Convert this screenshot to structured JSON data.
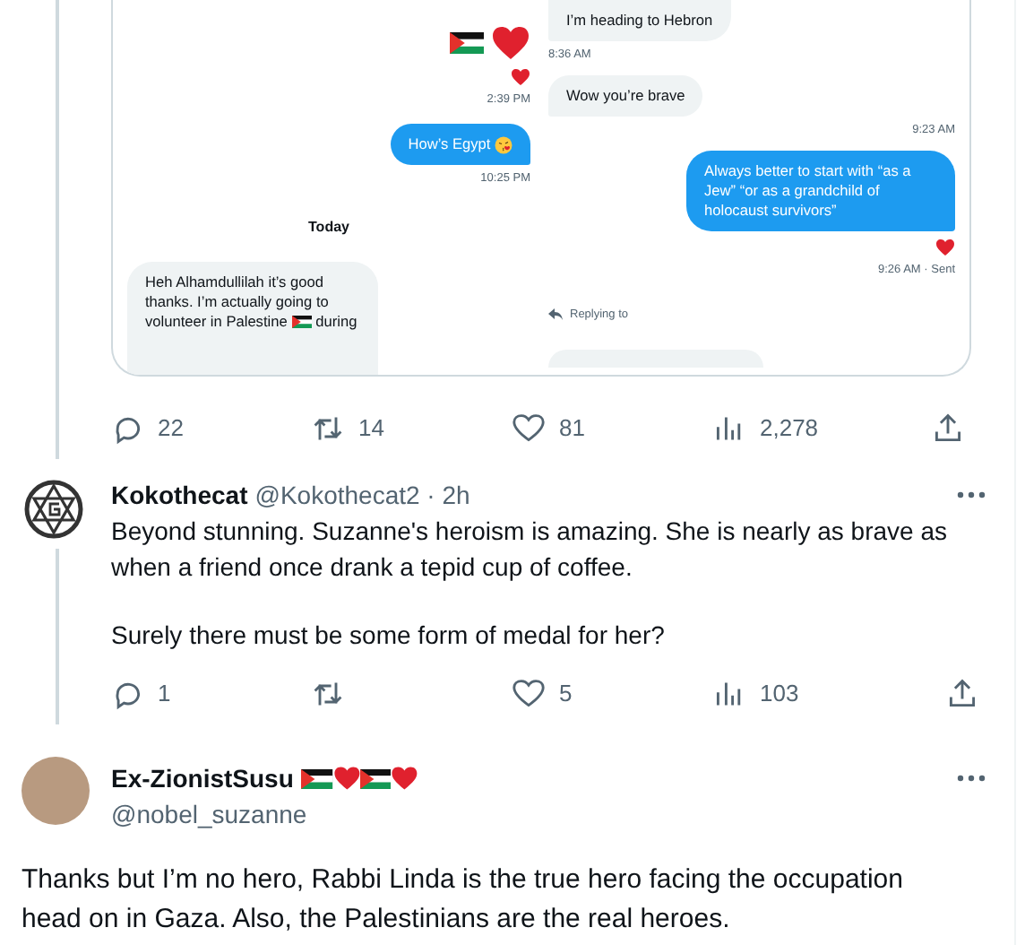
{
  "quoted_media": {
    "left_panel": [
      {
        "kind": "emoji",
        "icons": [
          {
            "kind": "flag"
          },
          {
            "kind": "heart"
          }
        ]
      },
      {
        "kind": "reaction"
      },
      {
        "kind": "time",
        "text": "2:39 PM"
      },
      {
        "kind": "bubble",
        "from_me": true,
        "segments": [
          {
            "kind": "text",
            "text": "How’s Egypt"
          },
          {
            "kind": "kiss"
          }
        ]
      },
      {
        "kind": "time",
        "text": "10:25 PM"
      },
      {
        "kind": "date",
        "text": "Today"
      },
      {
        "kind": "bubble",
        "from_me": false,
        "clipped_bottom": true,
        "segments": [
          {
            "kind": "text",
            "text": "Heh Alhamdullilah it’s good thanks. I’m actually going to volunteer in Palestine"
          },
          {
            "kind": "flag"
          },
          {
            "kind": "text",
            "text": "during"
          }
        ]
      }
    ],
    "right_panel": [
      {
        "kind": "bubble",
        "from_me": false,
        "clipped_top": true,
        "segments": [
          {
            "kind": "text",
            "text": "I’m heading to Hebron"
          }
        ]
      },
      {
        "kind": "time",
        "text": "8:36 AM",
        "left_aligned": true
      },
      {
        "kind": "bubble",
        "from_me": false,
        "segments": [
          {
            "kind": "text",
            "text": "Wow you’re brave"
          }
        ]
      },
      {
        "kind": "time",
        "text": "9:23 AM"
      },
      {
        "kind": "bubble",
        "from_me": true,
        "segments": [
          {
            "kind": "text",
            "text": "Always better to start with “as a Jew” “or as a grandchild of holocaust survivors”"
          }
        ]
      },
      {
        "kind": "reaction"
      },
      {
        "kind": "time",
        "text": "9:26 AM · Sent"
      },
      {
        "kind": "replying",
        "text": "Replying to"
      }
    ]
  },
  "actions": [
    {
      "kind": "reply",
      "count": "22"
    },
    {
      "kind": "retweet",
      "count": "14"
    },
    {
      "kind": "like",
      "count": "81"
    },
    {
      "kind": "views",
      "count": "2,278"
    },
    {
      "kind": "share"
    }
  ],
  "replies": [
    {
      "avatar": {
        "kind": "star"
      },
      "name": "Kokothecat",
      "handle": "@Kokothecat2 · 2h",
      "paragraphs": [
        "Beyond stunning. Suzanne's heroism is amazing. She is nearly as brave as when a friend once drank a tepid cup of coffee.",
        "Surely there must be some form of medal for her?"
      ],
      "actions": [
        {
          "kind": "reply",
          "count": "1"
        },
        {
          "kind": "retweet"
        },
        {
          "kind": "like",
          "count": "5"
        },
        {
          "kind": "views",
          "count": "103"
        },
        {
          "kind": "share"
        }
      ]
    },
    {
      "avatar": {
        "kind": "photo"
      },
      "name": "Ex-ZionistSusu",
      "handle": "@nobel_suzanne",
      "badges": [
        {
          "kind": "flag"
        },
        {
          "kind": "heart"
        },
        {
          "kind": "flag"
        },
        {
          "kind": "heart"
        }
      ],
      "paragraphs": [
        "Thanks but I’m no hero, Rabbi Linda is the true hero facing the occupation head on in Gaza. Also, the Palestinians are the real heroes."
      ]
    }
  ]
}
